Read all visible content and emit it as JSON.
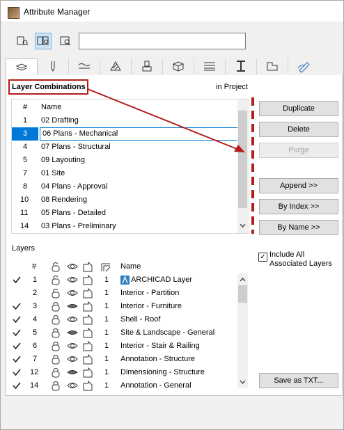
{
  "window": {
    "title": "Attribute Manager"
  },
  "search": {
    "value": ""
  },
  "tabs": [
    {
      "icon": "layers-icon"
    },
    {
      "icon": "pen-icon"
    },
    {
      "icon": "line-icon"
    },
    {
      "icon": "fill-icon"
    },
    {
      "icon": "surface-icon"
    },
    {
      "icon": "building-material-icon"
    },
    {
      "icon": "composite-icon"
    },
    {
      "icon": "profile-icon"
    },
    {
      "icon": "zone-icon"
    },
    {
      "icon": "markup-icon"
    }
  ],
  "combinations": {
    "title": "Layer Combinations",
    "scope": "in Project",
    "headers": {
      "num": "#",
      "name": "Name"
    },
    "rows": [
      {
        "num": "1",
        "name": "02 Drafting"
      },
      {
        "num": "3",
        "name": "06 Plans - Mechanical",
        "selected": true
      },
      {
        "num": "4",
        "name": "07 Plans - Structural"
      },
      {
        "num": "5",
        "name": "09 Layouting"
      },
      {
        "num": "7",
        "name": "01 Site"
      },
      {
        "num": "8",
        "name": "04 Plans - Approval"
      },
      {
        "num": "10",
        "name": "08 Rendering"
      },
      {
        "num": "11",
        "name": "05 Plans - Detailed"
      },
      {
        "num": "14",
        "name": "03 Plans - Preliminary"
      }
    ]
  },
  "buttons": {
    "duplicate": "Duplicate",
    "delete": "Delete",
    "purge": "Purge",
    "append": "Append >>",
    "by_index": "By Index >>",
    "by_name": "By Name >>",
    "save_txt": "Save as TXT..."
  },
  "layers": {
    "title": "Layers",
    "include_all": "Include All\nAssociated Layers",
    "include_line1": "Include All",
    "include_line2": "Associated Layers",
    "headers": {
      "num": "#",
      "name": "Name"
    },
    "rows": [
      {
        "check": true,
        "num": "1",
        "lock": "open",
        "vis": "shown",
        "ix": "1",
        "name": "ARCHICAD Layer",
        "special": true
      },
      {
        "check": false,
        "num": "2",
        "lock": "open",
        "vis": "shown",
        "ix": "1",
        "name": "Interior - Partition"
      },
      {
        "check": true,
        "num": "3",
        "lock": "closed",
        "vis": "hidden",
        "ix": "1",
        "name": "Interior - Furniture"
      },
      {
        "check": true,
        "num": "4",
        "lock": "closed",
        "vis": "shown",
        "ix": "1",
        "name": "Shell - Roof"
      },
      {
        "check": true,
        "num": "5",
        "lock": "closed",
        "vis": "hidden",
        "ix": "1",
        "name": "Site & Landscape - General"
      },
      {
        "check": true,
        "num": "6",
        "lock": "closed",
        "vis": "shown",
        "ix": "1",
        "name": "Interior - Stair & Railing"
      },
      {
        "check": true,
        "num": "7",
        "lock": "closed",
        "vis": "shown",
        "ix": "1",
        "name": "Annotation - Structure"
      },
      {
        "check": true,
        "num": "12",
        "lock": "closed",
        "vis": "hidden",
        "ix": "1",
        "name": "Dimensioning - Structure"
      },
      {
        "check": true,
        "num": "14",
        "lock": "closed",
        "vis": "shown",
        "ix": "1",
        "name": "Annotation - General"
      }
    ]
  },
  "colors": {
    "selection": "#0078d7",
    "annotation_red": "#b51c1c"
  }
}
